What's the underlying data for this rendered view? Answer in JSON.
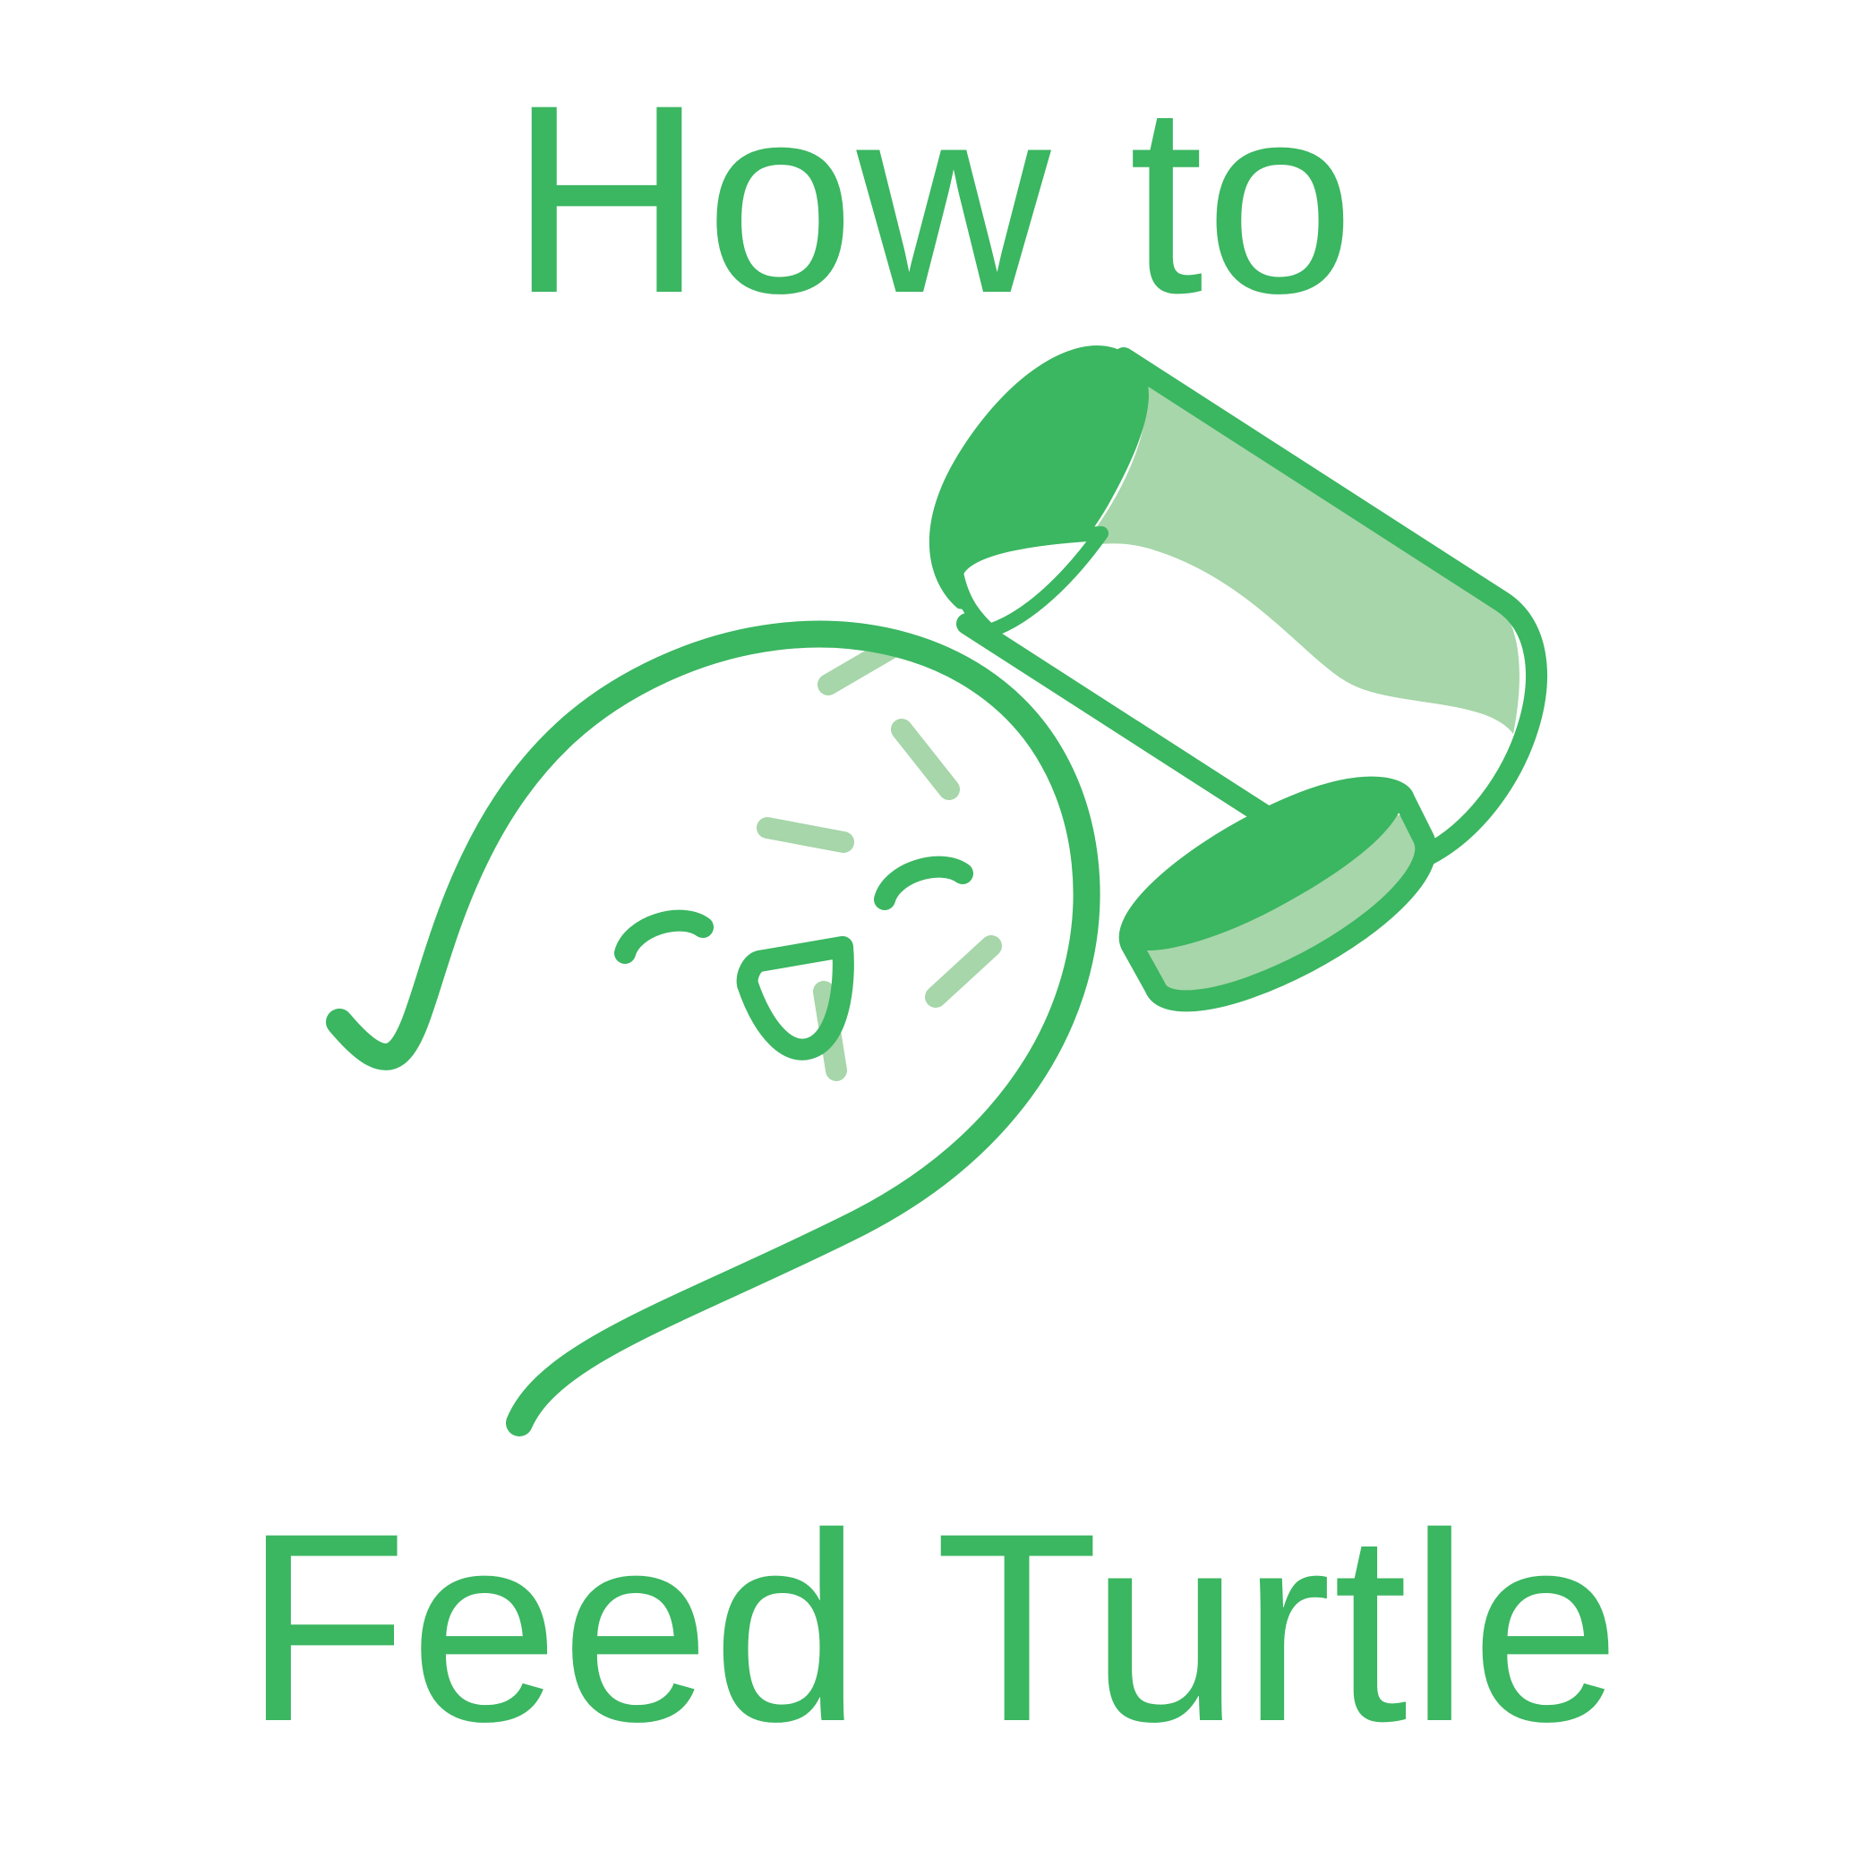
{
  "title": {
    "line1": "How to",
    "line2": "Feed Turtle"
  },
  "colors": {
    "primary": "#3bb661",
    "light": "#a6d6a9",
    "background": "#ffffff"
  },
  "illustration": {
    "subject": "turtle-icon",
    "object": "food-can-icon"
  }
}
